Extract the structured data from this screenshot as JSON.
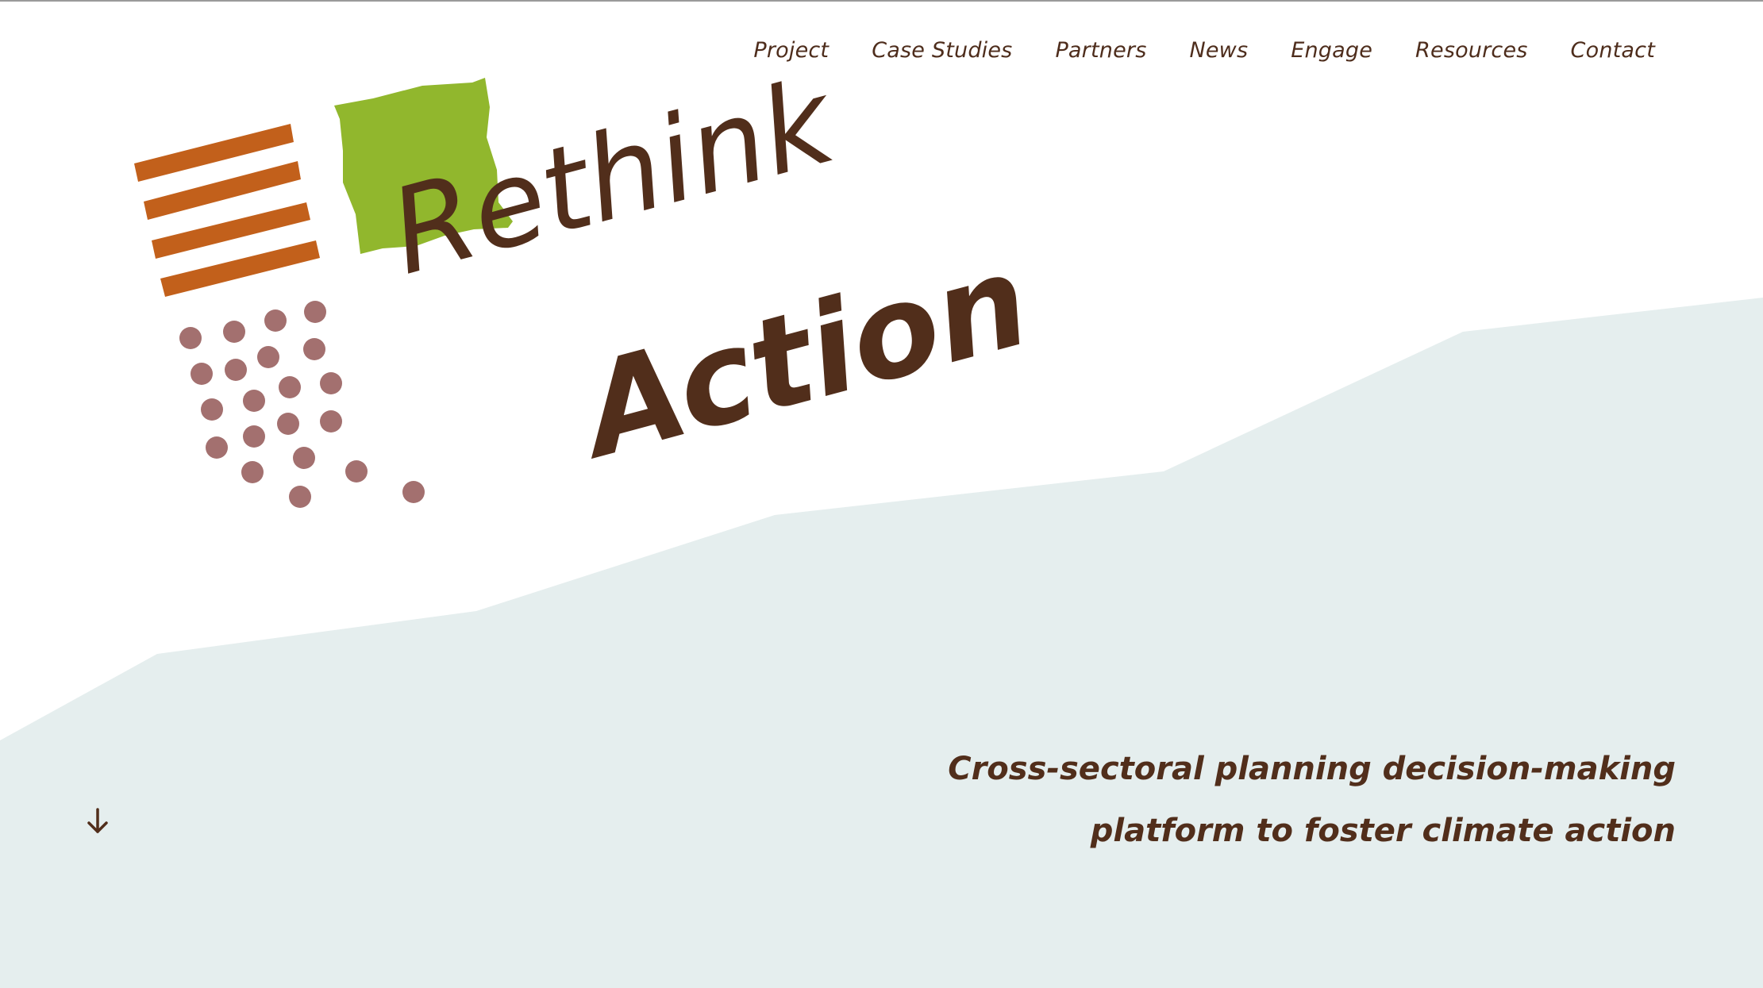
{
  "nav": {
    "items": [
      {
        "label": "Project"
      },
      {
        "label": "Case Studies"
      },
      {
        "label": "Partners"
      },
      {
        "label": "News"
      },
      {
        "label": "Engage"
      },
      {
        "label": "Resources"
      },
      {
        "label": "Contact"
      }
    ]
  },
  "logo": {
    "word1": "Rethink",
    "word2": "Action"
  },
  "hero": {
    "tagline_line1": "Cross-sectoral planning decision-making",
    "tagline_line2": "platform to foster climate action"
  },
  "icons": {
    "scroll": "arrow-down-icon"
  },
  "colors": {
    "brown": "#512e1b",
    "orange": "#c2601b",
    "green": "#91b72d",
    "dots": "#a3706f",
    "hero_band": "#e5eeee"
  }
}
